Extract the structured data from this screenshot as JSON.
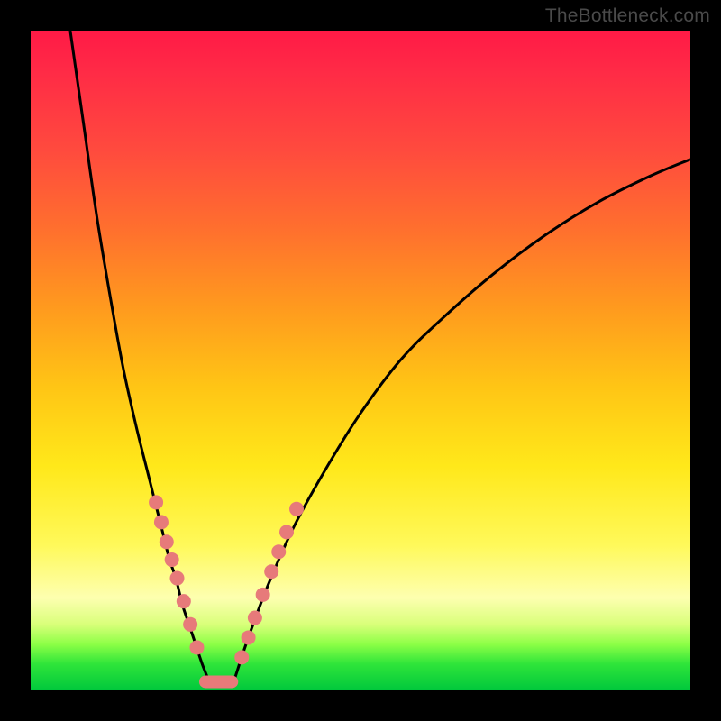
{
  "attribution": "TheBottleneck.com",
  "chart_data": {
    "type": "line",
    "title": "",
    "xlabel": "",
    "ylabel": "",
    "xlim": [
      0,
      100
    ],
    "ylim": [
      0,
      100
    ],
    "grid": false,
    "legend": false,
    "series": [
      {
        "name": "left-curve",
        "x": [
          6,
          8,
          10,
          12,
          14,
          16,
          18,
          20,
          21,
          22,
          23,
          24,
          25,
          26,
          27
        ],
        "y": [
          100,
          86,
          72,
          60,
          49,
          40,
          32,
          24,
          20,
          17,
          13,
          10,
          7,
          4,
          1.5
        ]
      },
      {
        "name": "right-curve",
        "x": [
          31,
          33,
          36,
          40,
          45,
          50,
          56,
          62,
          70,
          78,
          86,
          94,
          100
        ],
        "y": [
          2,
          8,
          16,
          25,
          34,
          42,
          50,
          56,
          63,
          69,
          74,
          78,
          80.5
        ]
      }
    ],
    "markers": {
      "left_cluster": [
        {
          "x": 19.0,
          "y": 28.5
        },
        {
          "x": 19.8,
          "y": 25.5
        },
        {
          "x": 20.6,
          "y": 22.5
        },
        {
          "x": 21.4,
          "y": 19.8
        },
        {
          "x": 22.2,
          "y": 17.0
        },
        {
          "x": 23.2,
          "y": 13.5
        },
        {
          "x": 24.2,
          "y": 10.0
        },
        {
          "x": 25.2,
          "y": 6.5
        }
      ],
      "right_cluster": [
        {
          "x": 32.0,
          "y": 5.0
        },
        {
          "x": 33.0,
          "y": 8.0
        },
        {
          "x": 34.0,
          "y": 11.0
        },
        {
          "x": 35.2,
          "y": 14.5
        },
        {
          "x": 36.5,
          "y": 18.0
        },
        {
          "x": 37.6,
          "y": 21.0
        },
        {
          "x": 38.8,
          "y": 24.0
        },
        {
          "x": 40.3,
          "y": 27.5
        }
      ],
      "bottom_notch": {
        "x1": 26.5,
        "x2": 30.5,
        "y": 1.3
      }
    },
    "marker_radius_px": 8
  }
}
